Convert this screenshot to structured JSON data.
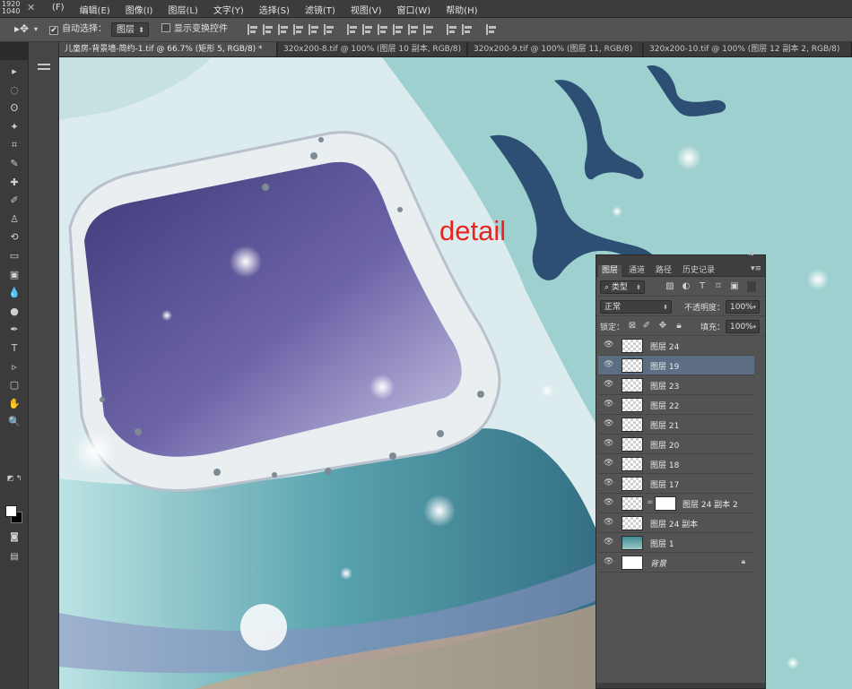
{
  "window": {
    "resolution_top": "1920",
    "resolution_bottom": "1040",
    "close_glyph": "✕"
  },
  "menu": {
    "items": [
      "(F)",
      "编辑(E)",
      "图像(I)",
      "图层(L)",
      "文字(Y)",
      "选择(S)",
      "滤镜(T)",
      "视图(V)",
      "窗口(W)",
      "帮助(H)"
    ]
  },
  "options": {
    "move_tool_icon": "move-tool-icon",
    "auto_select_label": "自动选择：",
    "auto_select_checked": true,
    "auto_select_value": "图层",
    "show_transform_label": "显示变换控件",
    "show_transform_checked": false
  },
  "tabs": [
    {
      "label": "儿童房-背景墙-简约-1.tif @ 66.7% (矩形 5, RGB/8) *",
      "active": true
    },
    {
      "label": "320x200-8.tif @ 100% (图层 10 副本, RGB/8)",
      "active": false
    },
    {
      "label": "320x200-9.tif @ 100% (图层 11, RGB/8)",
      "active": false
    },
    {
      "label": "320x200-10.tif @ 100% (图层 12 副本 2, RGB/8)",
      "active": false
    }
  ],
  "toolbox": {
    "tools": [
      "move-tool",
      "marquee-tool",
      "lasso-tool",
      "magic-wand-tool",
      "crop-tool",
      "eyedropper-tool",
      "healing-brush-tool",
      "brush-tool",
      "clone-stamp-tool",
      "history-brush-tool",
      "eraser-tool",
      "gradient-tool",
      "blur-tool",
      "dodge-tool",
      "pen-tool",
      "type-tool",
      "path-selection-tool",
      "rectangle-tool",
      "hand-tool",
      "zoom-tool"
    ],
    "glyphs": [
      "▸",
      "◌",
      "ʘ",
      "✦",
      "⌗",
      "✎",
      "✚",
      "✐",
      "♙",
      "⟲",
      "▭",
      "▣",
      "💧",
      "●",
      "✒",
      "T",
      "▹",
      "▢",
      "✋",
      "🔍"
    ],
    "quick_mask_icon": "quick-mask-icon",
    "screen_mode_icon": "screen-mode-icon"
  },
  "canvas": {
    "detail_text": "detail",
    "background_color": "#9fd0d0"
  },
  "layers_panel": {
    "collapse_glyph": "«",
    "close_glyph": "✕",
    "tabs": [
      "图层",
      "通道",
      "路径",
      "历史记录"
    ],
    "active_tab": "图层",
    "filter_kind": "类型",
    "blend_mode": "正常",
    "opacity_label": "不透明度：",
    "opacity_value": "100%",
    "lock_label": "锁定：",
    "fill_label": "填充：",
    "fill_value": "100%",
    "layers": [
      {
        "name": "图层 24",
        "thumb": "transparent",
        "selected": false
      },
      {
        "name": "图层 19",
        "thumb": "transparent",
        "selected": true
      },
      {
        "name": "图层 23",
        "thumb": "transparent",
        "selected": false
      },
      {
        "name": "图层 22",
        "thumb": "transparent",
        "selected": false
      },
      {
        "name": "图层 21",
        "thumb": "transparent",
        "selected": false
      },
      {
        "name": "图层 20",
        "thumb": "transparent",
        "selected": false
      },
      {
        "name": "图层 18",
        "thumb": "transparent",
        "selected": false
      },
      {
        "name": "图层 17",
        "thumb": "transparent",
        "selected": false
      },
      {
        "name": "图层 24 副本 2",
        "thumb": "transparent",
        "selected": false,
        "mask": true
      },
      {
        "name": "图层 24 副本",
        "thumb": "transparent",
        "selected": false
      },
      {
        "name": "图层 1",
        "thumb": "teal",
        "selected": false
      },
      {
        "name": "背景",
        "thumb": "white",
        "selected": false,
        "locked": true
      }
    ]
  },
  "colors": {
    "accent_selected_layer": "#5d6e84",
    "detail_text": "#e8241e",
    "bird": "#2c4f73"
  }
}
